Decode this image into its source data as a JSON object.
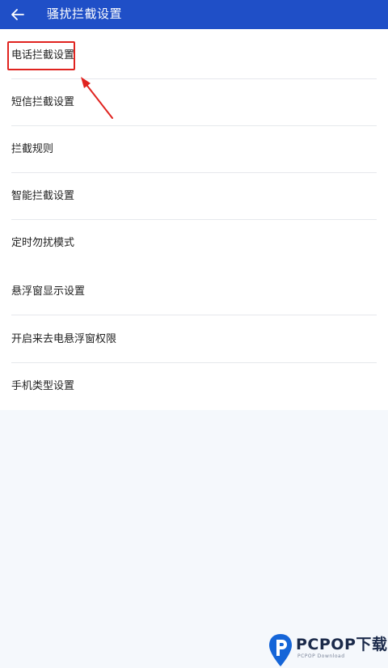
{
  "header": {
    "title": "骚扰拦截设置",
    "back_icon": "arrow-left-icon"
  },
  "menu": {
    "items": [
      {
        "label": "电话拦截设置",
        "highlighted": true
      },
      {
        "label": "短信拦截设置"
      },
      {
        "label": "拦截规则"
      },
      {
        "label": "智能拦截设置"
      },
      {
        "label": "定时勿扰模式"
      },
      {
        "label": "悬浮窗显示设置"
      },
      {
        "label": "开启来去电悬浮窗权限"
      },
      {
        "label": "手机类型设置"
      }
    ]
  },
  "watermark": {
    "brand": "PCPOP下载",
    "subtitle": "PCPOP Download"
  },
  "colors": {
    "header_bg": "#1f4fc7",
    "highlight": "#e0231f",
    "page_bg": "#f5f8fc"
  }
}
